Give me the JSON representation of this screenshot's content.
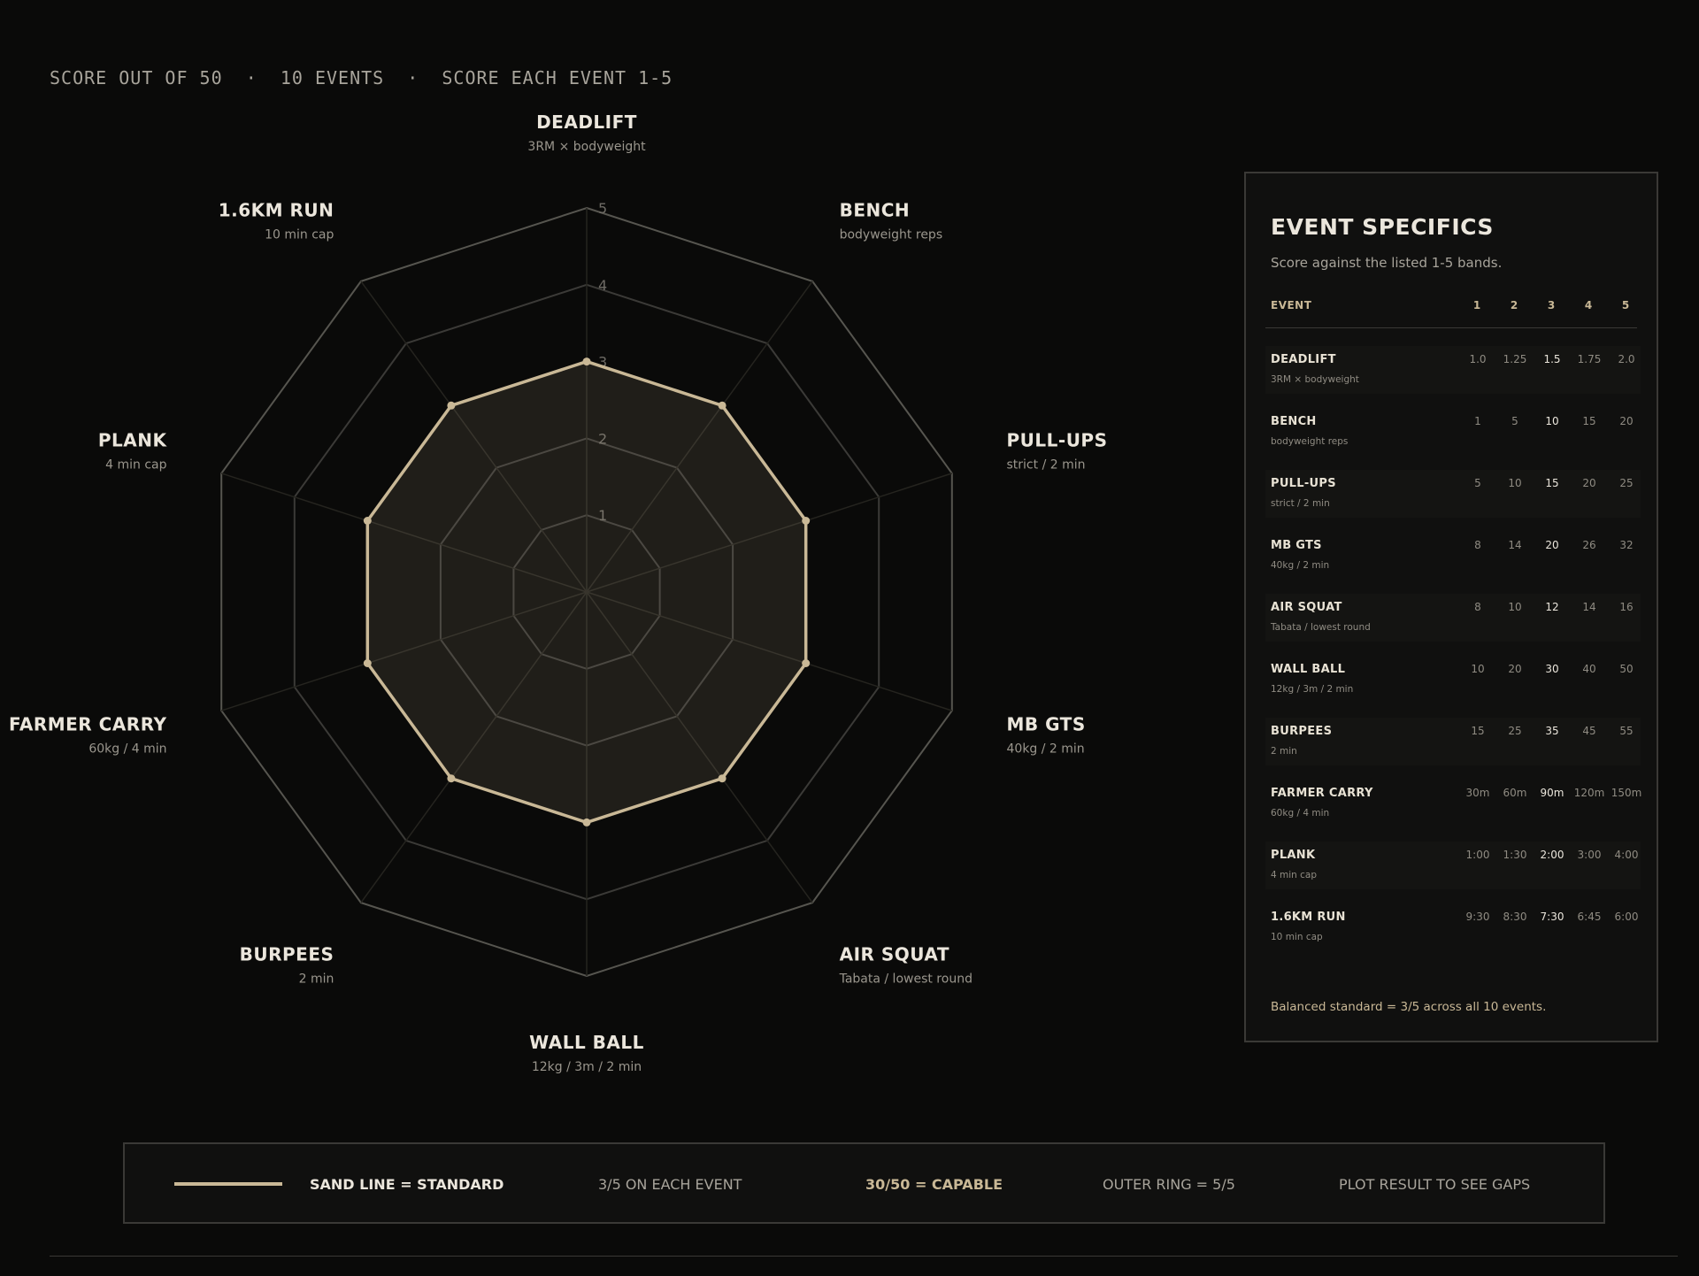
{
  "header": {
    "text": "SCORE OUT OF 50  ·  10 EVENTS  ·  SCORE EACH EVENT 1-5"
  },
  "chart_data": {
    "type": "radar",
    "axes": [
      {
        "name": "DEADLIFT",
        "note": "3RM × bodyweight"
      },
      {
        "name": "BENCH",
        "note": "bodyweight reps"
      },
      {
        "name": "PULL-UPS",
        "note": "strict / 2 min"
      },
      {
        "name": "MB GTS",
        "note": "40kg / 2 min"
      },
      {
        "name": "AIR SQUAT",
        "note": "Tabata / lowest round"
      },
      {
        "name": "WALL BALL",
        "note": "12kg / 3m / 2 min"
      },
      {
        "name": "BURPEES",
        "note": "2 min"
      },
      {
        "name": "FARMER CARRY",
        "note": "60kg / 4 min"
      },
      {
        "name": "PLANK",
        "note": "4 min cap"
      },
      {
        "name": "1.6KM RUN",
        "note": "10 min cap"
      }
    ],
    "scale": {
      "min": 0,
      "max": 5,
      "ticks": [
        "1",
        "2",
        "3",
        "4",
        "5"
      ]
    },
    "series": [
      {
        "values": [
          3,
          3,
          3,
          3,
          3,
          3,
          3,
          3,
          3,
          3
        ],
        "color": "#c9b896"
      }
    ],
    "grid_color": "#3b3a37",
    "outer_ring_color": "#56554f"
  },
  "panel": {
    "title": "EVENT SPECIFICS",
    "subtitle": "Score against the listed 1-5 bands.",
    "header_event": "EVENT",
    "header_cols": [
      "1",
      "2",
      "3",
      "4",
      "5"
    ],
    "rows": [
      {
        "name": "DEADLIFT",
        "note": "3RM × bodyweight",
        "values": [
          "1.0",
          "1.25",
          "1.5",
          "1.75",
          "2.0"
        ]
      },
      {
        "name": "BENCH",
        "note": "bodyweight reps",
        "values": [
          "1",
          "5",
          "10",
          "15",
          "20"
        ]
      },
      {
        "name": "PULL-UPS",
        "note": "strict / 2 min",
        "values": [
          "5",
          "10",
          "15",
          "20",
          "25"
        ]
      },
      {
        "name": "MB GTS",
        "note": "40kg / 2 min",
        "values": [
          "8",
          "14",
          "20",
          "26",
          "32"
        ]
      },
      {
        "name": "AIR SQUAT",
        "note": "Tabata / lowest round",
        "values": [
          "8",
          "10",
          "12",
          "14",
          "16"
        ]
      },
      {
        "name": "WALL BALL",
        "note": "12kg / 3m / 2 min",
        "values": [
          "10",
          "20",
          "30",
          "40",
          "50"
        ]
      },
      {
        "name": "BURPEES",
        "note": "2 min",
        "values": [
          "15",
          "25",
          "35",
          "45",
          "55"
        ]
      },
      {
        "name": "FARMER CARRY",
        "note": "60kg / 4 min",
        "values": [
          "30m",
          "60m",
          "90m",
          "120m",
          "150m"
        ]
      },
      {
        "name": "PLANK",
        "note": "4 min cap",
        "values": [
          "1:00",
          "1:30",
          "2:00",
          "3:00",
          "4:00"
        ]
      },
      {
        "name": "1.6KM RUN",
        "note": "10 min cap",
        "values": [
          "9:30",
          "8:30",
          "7:30",
          "6:45",
          "6:00"
        ]
      }
    ],
    "footer": "Balanced standard = 3/5 across all 10 events."
  },
  "legend": {
    "line_label": "SAND LINE = STANDARD",
    "item2": "3/5 ON EACH EVENT",
    "item3": "30/50 = CAPABLE",
    "item4": "OUTER RING = 5/5",
    "item5": "PLOT RESULT TO SEE GAPS"
  }
}
